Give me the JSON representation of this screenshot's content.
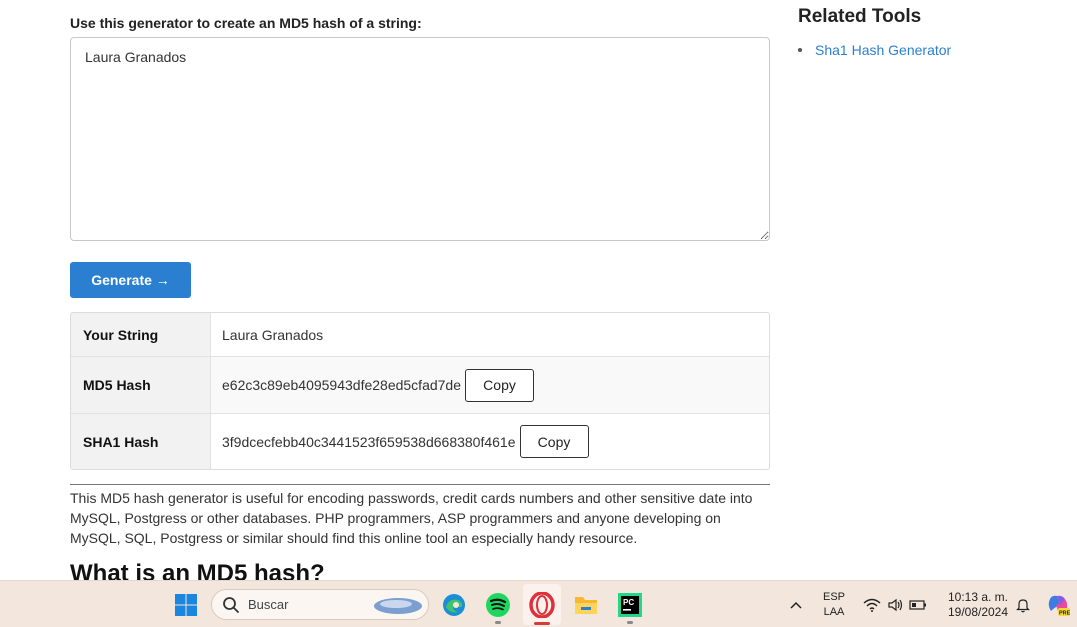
{
  "main": {
    "label": "Use this generator to create an MD5 hash of a string:",
    "input_value": "Laura Granados",
    "generate_label": "Generate →",
    "results": [
      {
        "key": "Your String",
        "value": "Laura Granados",
        "copy": ""
      },
      {
        "key": "MD5 Hash",
        "value": "e62c3c89eb4095943dfe28ed5cfad7de",
        "copy": "Copy"
      },
      {
        "key": "SHA1 Hash",
        "value": "3f9dcecfebb40c3441523f659538d668380f461e",
        "copy": "Copy"
      }
    ],
    "description": "This MD5 hash generator is useful for encoding passwords, credit cards numbers and other sensitive date into MySQL, Postgress or other databases. PHP programmers, ASP programmers and anyone developing on MySQL, SQL, Postgress or similar should find this online tool an especially handy resource.",
    "next_heading": "What is an MD5 hash?"
  },
  "sidebar": {
    "title": "Related Tools",
    "links": [
      "Sha1 Hash Generator"
    ]
  },
  "taskbar": {
    "search_placeholder": "Buscar",
    "apps": [
      "start-icon",
      "edge-icon",
      "spotify-icon",
      "opera-icon",
      "file-explorer-icon",
      "pycharm-icon"
    ],
    "lang_top": "ESP",
    "lang_bottom": "LAA",
    "time": "10:13 a. m.",
    "date": "19/08/2024"
  },
  "colors": {
    "accent": "#2b7fd1",
    "taskbar_bg": "#f3e6dc"
  }
}
